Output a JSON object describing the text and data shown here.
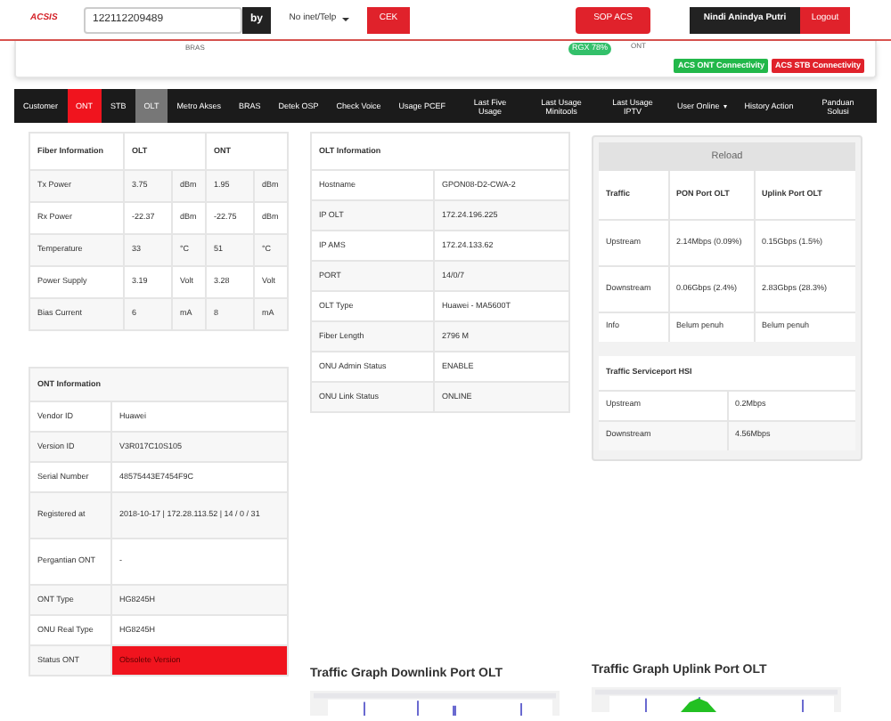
{
  "header": {
    "logo": "ACSIS",
    "search_value": "122112209489",
    "by_label": "by",
    "select_value": "No inet/Telp",
    "cek_button": "CEK",
    "sop_button": "SOP ACS",
    "user_name": "Nindi Anindya Putri",
    "logout_button": "Logout"
  },
  "summary": {
    "bras_label": "BRAS",
    "rx_badge": "RGX 78%",
    "ont_label": "ONT",
    "badges": [
      {
        "label": "ACS ONT Connectivity",
        "color": "#22b84a"
      },
      {
        "label": "ACS STB Connectivity",
        "color": "#e0222b"
      }
    ]
  },
  "tabs": [
    {
      "label": "Customer",
      "selected": false,
      "shaded": false,
      "dropdown": false
    },
    {
      "label": "ONT",
      "selected": true,
      "shaded": false,
      "dropdown": false
    },
    {
      "label": "STB",
      "selected": false,
      "shaded": false,
      "dropdown": false
    },
    {
      "label": "OLT",
      "selected": false,
      "shaded": true,
      "dropdown": false
    },
    {
      "label": "Metro Akses",
      "selected": false,
      "shaded": false,
      "dropdown": false
    },
    {
      "label": "BRAS",
      "selected": false,
      "shaded": false,
      "dropdown": false
    },
    {
      "label": "Detek OSP",
      "selected": false,
      "shaded": false,
      "dropdown": false
    },
    {
      "label": "Check Voice",
      "selected": false,
      "shaded": false,
      "dropdown": false
    },
    {
      "label": "Usage PCEF",
      "selected": false,
      "shaded": false,
      "dropdown": false
    },
    {
      "label": "Last Five Usage",
      "selected": false,
      "shaded": false,
      "dropdown": false
    },
    {
      "label": "Last Usage Minitools",
      "selected": false,
      "shaded": false,
      "dropdown": false
    },
    {
      "label": "Last Usage IPTV",
      "selected": false,
      "shaded": false,
      "dropdown": false
    },
    {
      "label": "User Online",
      "selected": false,
      "shaded": false,
      "dropdown": true
    },
    {
      "label": "History Action",
      "selected": false,
      "shaded": false,
      "dropdown": false
    },
    {
      "label": "Panduan Solusi",
      "selected": false,
      "shaded": false,
      "dropdown": false
    }
  ],
  "fiber_table": {
    "columns": [
      "Fiber Information",
      "OLT",
      "ONT"
    ],
    "rows": [
      {
        "label": "Tx Power",
        "olt": {
          "value": "3.75",
          "unit": "dBm"
        },
        "ont": {
          "value": "1.95",
          "unit": "dBm"
        }
      },
      {
        "label": "Rx Power",
        "olt": {
          "value": "-22.37",
          "unit": "dBm"
        },
        "ont": {
          "value": "-22.75",
          "unit": "dBm"
        }
      },
      {
        "label": "Temperature",
        "olt": {
          "value": "33",
          "unit": "°C"
        },
        "ont": {
          "value": "51",
          "unit": "°C"
        }
      },
      {
        "label": "Power Supply",
        "olt": {
          "value": "3.19",
          "unit": "Volt"
        },
        "ont": {
          "value": "3.28",
          "unit": "Volt"
        }
      },
      {
        "label": "Bias Current",
        "olt": {
          "value": "6",
          "unit": "mA"
        },
        "ont": {
          "value": "8",
          "unit": "mA"
        }
      }
    ]
  },
  "ont_info": {
    "title": "ONT Information",
    "rows": [
      {
        "label": "Vendor ID",
        "value": "Huawei",
        "alert": false
      },
      {
        "label": "Version ID",
        "value": "V3R017C10S105",
        "alert": false
      },
      {
        "label": "Serial Number",
        "value": "48575443E7454F9C",
        "alert": false
      },
      {
        "label": "Registered at",
        "value": "2018-10-17 | 172.28.113.52 | 14 / 0 / 31",
        "alert": false
      },
      {
        "label": "Pergantian ONT",
        "value": "-",
        "alert": false
      },
      {
        "label": "ONT Type",
        "value": "HG8245H",
        "alert": false
      },
      {
        "label": "ONU Real Type",
        "value": "HG8245H",
        "alert": false
      },
      {
        "label": "Status ONT",
        "value": "Obsolete Version",
        "alert": true
      }
    ]
  },
  "olt_info": {
    "title": "OLT Information",
    "rows": [
      {
        "label": "Hostname",
        "value": "GPON08-D2-CWA-2"
      },
      {
        "label": "IP OLT",
        "value": "172.24.196.225"
      },
      {
        "label": "IP AMS",
        "value": "172.24.133.62"
      },
      {
        "label": "PORT",
        "value": "14/0/7"
      },
      {
        "label": "OLT Type",
        "value": "Huawei - MA5600T"
      },
      {
        "label": "Fiber Length",
        "value": "2796 M"
      },
      {
        "label": "ONU Admin Status",
        "value": "ENABLE"
      },
      {
        "label": "ONU Link Status",
        "value": "ONLINE"
      }
    ]
  },
  "traffic": {
    "reload_button": "Reload",
    "columns": [
      "Traffic",
      "PON Port OLT",
      "Uplink Port OLT"
    ],
    "rows": [
      [
        "Upstream",
        "2.14Mbps (0.09%)",
        "0.15Gbps (1.5%)"
      ],
      [
        "Downstream",
        "0.06Gbps (2.4%)",
        "2.83Gbps (28.3%)"
      ],
      [
        "Info",
        "Belum penuh",
        "Belum penuh"
      ]
    ]
  },
  "serviceport": {
    "title": "Traffic Serviceport HSI",
    "rows": [
      [
        "Upstream",
        "0.2Mbps"
      ],
      [
        "Downstream",
        "4.56Mbps"
      ]
    ]
  },
  "graphs": [
    {
      "title": "Traffic Graph Downlink Port OLT",
      "kind": "picture"
    },
    {
      "title": "Traffic Graph Uplink Port OLT",
      "kind": "picture"
    }
  ]
}
